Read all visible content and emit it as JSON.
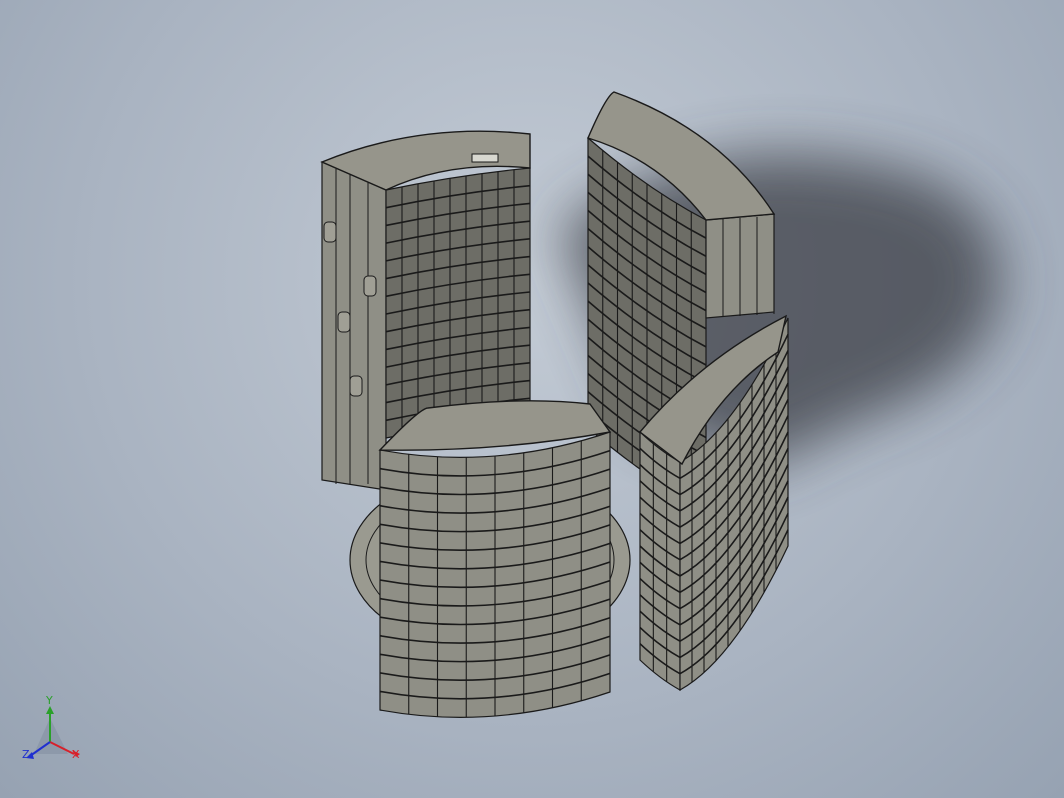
{
  "viewport": {
    "background_top": "#c3cbd5",
    "background_bottom": "#96a2b2"
  },
  "model": {
    "wall_color": "#8f8f86",
    "wall_dark": "#6d6d66",
    "roof_color": "#96958b",
    "line_color": "#1a1a1a",
    "shadow_color": "#3b3e45"
  },
  "triad": {
    "x_label": "X",
    "y_label": "Y",
    "z_label": "Z",
    "x_color": "#d8202a",
    "y_color": "#2aa02a",
    "z_color": "#2030d0"
  }
}
